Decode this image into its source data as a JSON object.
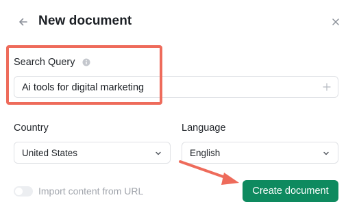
{
  "dialog": {
    "title": "New document"
  },
  "search_query": {
    "label": "Search Query",
    "value": "Ai tools for digital marketing"
  },
  "country": {
    "label": "Country",
    "selected": "United States"
  },
  "language": {
    "label": "Language",
    "selected": "English"
  },
  "import_toggle": {
    "label": "Import content from URL",
    "enabled": false
  },
  "actions": {
    "create_label": "Create document"
  },
  "colors": {
    "primary_button": "#0e8a5f",
    "annotation": "#ee6b5b"
  },
  "icons": [
    "arrow-left-icon",
    "close-icon",
    "info-icon",
    "plus-icon",
    "chevron-down-icon"
  ]
}
